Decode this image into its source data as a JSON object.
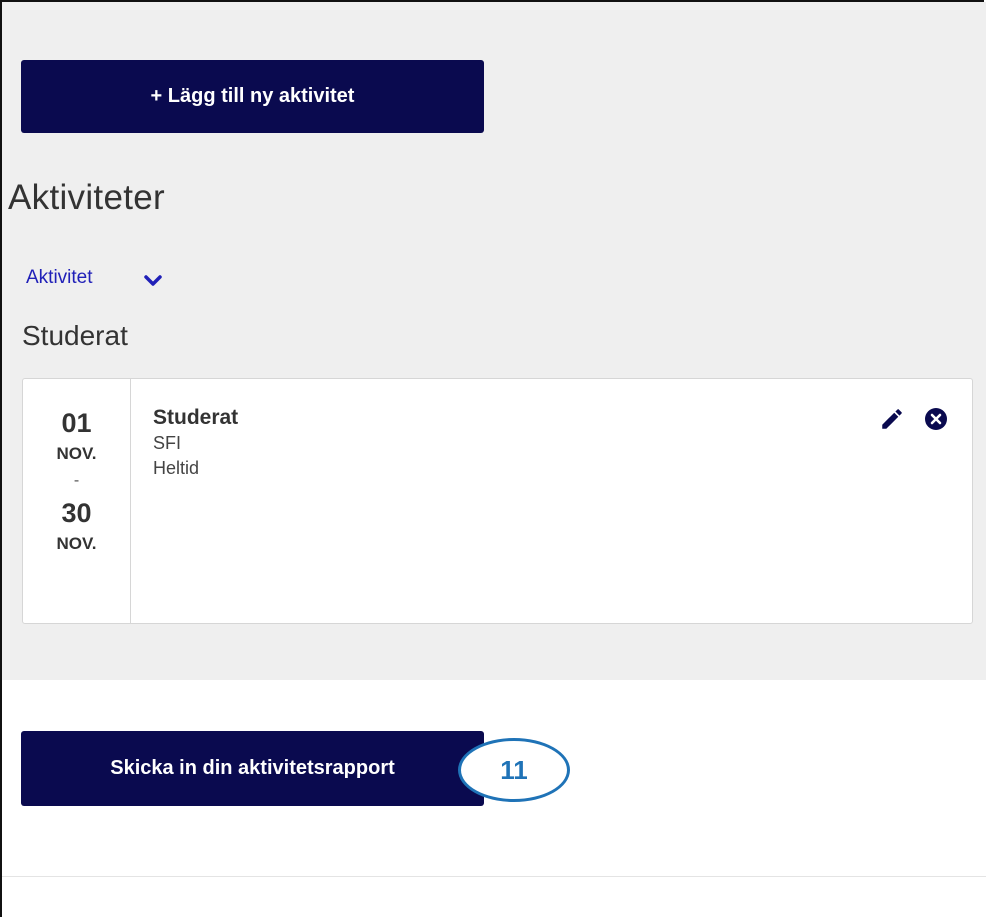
{
  "add_button": {
    "label": "+ Lägg till ny aktivitet"
  },
  "page": {
    "title": "Aktiviteter"
  },
  "filter": {
    "label": "Aktivitet",
    "icon": "chevron-down-icon"
  },
  "section": {
    "title": "Studerat"
  },
  "activity": {
    "start_day": "01",
    "start_month": "NOV.",
    "separator": "-",
    "end_day": "30",
    "end_month": "NOV.",
    "title": "Studerat",
    "line1": "SFI",
    "line2": "Heltid",
    "edit_icon": "pencil-icon",
    "delete_icon": "close-circle-icon"
  },
  "submit_button": {
    "label": "Skicka in din aktivitetsrapport"
  },
  "callout": {
    "number": "11"
  },
  "colors": {
    "primary": "#0a0a4f",
    "link": "#2020b8",
    "panel": "#efefef",
    "callout": "#1f73b7"
  }
}
